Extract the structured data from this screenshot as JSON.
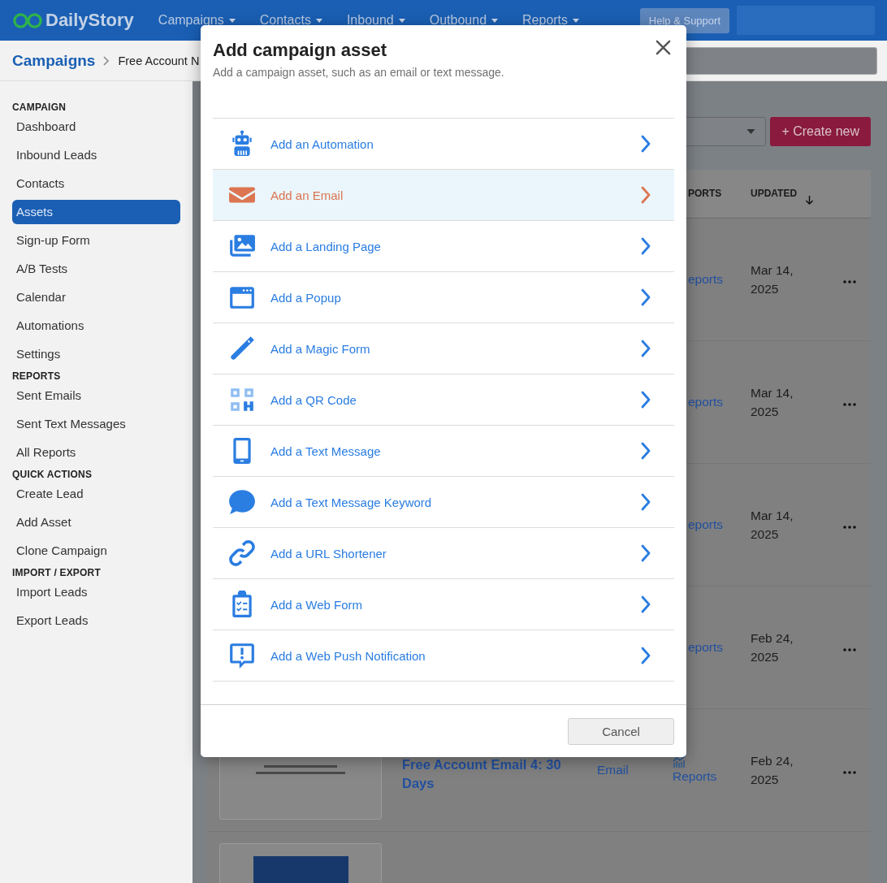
{
  "header": {
    "logo": "DailyStory",
    "nav": [
      "Campaigns",
      "Contacts",
      "Inbound",
      "Outbound",
      "Reports"
    ],
    "help_button": "Help & Support"
  },
  "breadcrumb": {
    "root": "Campaigns",
    "current": "Free Account N"
  },
  "sidebar": {
    "sections": [
      {
        "title": "CAMPAIGN",
        "items": [
          {
            "label": "Dashboard",
            "selected": false
          },
          {
            "label": "Inbound Leads",
            "selected": false
          },
          {
            "label": "Contacts",
            "selected": false
          },
          {
            "label": "Assets",
            "selected": true
          },
          {
            "label": "Sign-up Form",
            "selected": false
          },
          {
            "label": "A/B Tests",
            "selected": false
          },
          {
            "label": "Calendar",
            "selected": false
          },
          {
            "label": "Automations",
            "selected": false
          },
          {
            "label": "Settings",
            "selected": false
          }
        ]
      },
      {
        "title": "REPORTS",
        "items": [
          {
            "label": "Sent Emails",
            "selected": false
          },
          {
            "label": "Sent Text Messages",
            "selected": false
          },
          {
            "label": "All Reports",
            "selected": false
          }
        ]
      },
      {
        "title": "QUICK ACTIONS",
        "items": [
          {
            "label": "Create Lead",
            "selected": false
          },
          {
            "label": "Add Asset",
            "selected": false
          },
          {
            "label": "Clone Campaign",
            "selected": false
          }
        ]
      },
      {
        "title": "IMPORT / EXPORT",
        "items": [
          {
            "label": "Import Leads",
            "selected": false
          },
          {
            "label": "Export Leads",
            "selected": false
          }
        ]
      }
    ]
  },
  "toolbar": {
    "create_button": "+ Create new"
  },
  "table": {
    "columns": [
      "PORTS",
      "UPDATED"
    ],
    "rows": [
      {
        "kind": "covered",
        "reports": "eports",
        "updated": "Mar 14, 2025"
      },
      {
        "kind": "covered",
        "reports": "eports",
        "updated": "Mar 14, 2025"
      },
      {
        "kind": "covered",
        "reports": "eports",
        "updated": "Mar 14, 2025"
      },
      {
        "kind": "covered",
        "reports": "eports",
        "updated": "Feb 24, 2025"
      },
      {
        "kind": "email_preview",
        "title": "Free Account Email 4: 30 Days",
        "type": "Email",
        "reports": "Reports",
        "updated": "Feb 24, 2025"
      },
      {
        "kind": "photo_preview"
      }
    ]
  },
  "modal": {
    "title": "Add campaign asset",
    "subtitle": "Add a campaign asset, such as an email or text message.",
    "items": [
      {
        "kind": "automation",
        "label": "Add an Automation",
        "selected": false
      },
      {
        "kind": "email",
        "label": "Add an Email",
        "selected": true
      },
      {
        "kind": "landing",
        "label": "Add a Landing Page",
        "selected": false
      },
      {
        "kind": "popup",
        "label": "Add a Popup",
        "selected": false
      },
      {
        "kind": "magic",
        "label": "Add a Magic Form",
        "selected": false
      },
      {
        "kind": "qr",
        "label": "Add a QR Code",
        "selected": false
      },
      {
        "kind": "text",
        "label": "Add a Text Message",
        "selected": false
      },
      {
        "kind": "keyword",
        "label": "Add a Text Message Keyword",
        "selected": false
      },
      {
        "kind": "url",
        "label": "Add a URL Shortener",
        "selected": false
      },
      {
        "kind": "webform",
        "label": "Add a Web Form",
        "selected": false
      },
      {
        "kind": "push",
        "label": "Add a Web Push Notification",
        "selected": false
      }
    ],
    "cancel_button": "Cancel"
  }
}
